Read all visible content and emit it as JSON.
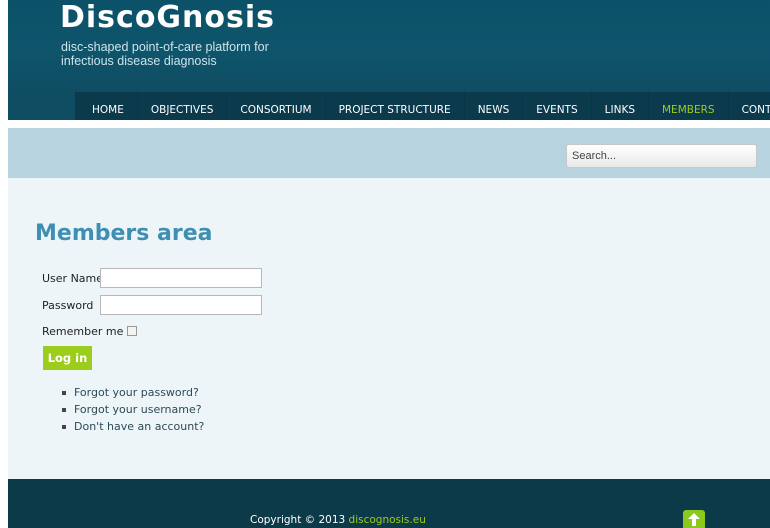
{
  "site": {
    "title": "DiscoGnosis",
    "tagline": "disc-shaped point-of-care platform for infectious disease diagnosis"
  },
  "nav": {
    "items": [
      {
        "label": "HOME"
      },
      {
        "label": "OBJECTIVES"
      },
      {
        "label": "CONSORTIUM"
      },
      {
        "label": "PROJECT STRUCTURE"
      },
      {
        "label": "NEWS"
      },
      {
        "label": "EVENTS"
      },
      {
        "label": "LINKS"
      },
      {
        "label": "MEMBERS",
        "active": true
      },
      {
        "label": "CONTACT"
      }
    ]
  },
  "search": {
    "placeholder": "Search..."
  },
  "members": {
    "title": "Members area",
    "username_label": "User Name",
    "password_label": "Password",
    "remember_label": "Remember me",
    "login_label": "Log in",
    "links": [
      "Forgot your password?",
      "Forgot your username?",
      "Don't have an account?"
    ]
  },
  "footer": {
    "copyright_prefix": "Copyright © 2013",
    "copyright_link": "discognosis.eu",
    "top_icon": "arrow-up-icon"
  },
  "colors": {
    "header_bg": "#0f4d63",
    "nav_bg": "#0b3a4d",
    "accent": "#9ccc1c",
    "search_band": "#b6d3df",
    "content_bg": "#eef5f8",
    "title": "#3f8fb2",
    "footer_bg": "#0d3a49"
  }
}
